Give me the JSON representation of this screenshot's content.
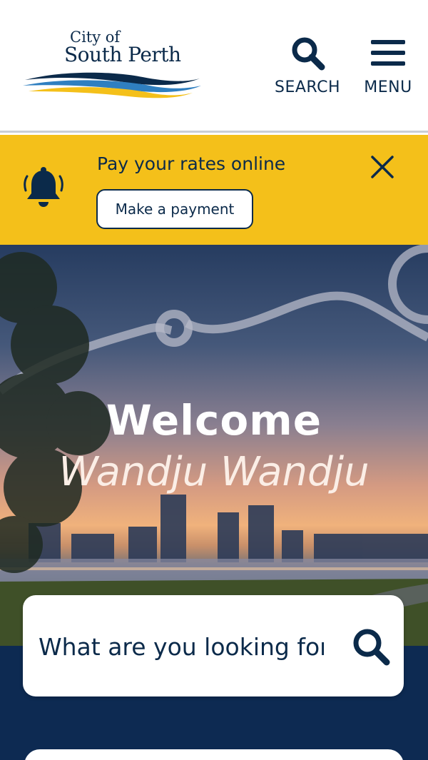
{
  "brand": {
    "city_of": "City of",
    "name": "South Perth",
    "colors": {
      "navy": "#0b2a4a",
      "yellow": "#f4c01a",
      "blue": "#2f7fc0",
      "band": "#0d2a52"
    }
  },
  "header": {
    "search_label": "SEARCH",
    "menu_label": "MENU",
    "search_icon": "search-icon",
    "menu_icon": "hamburger-icon"
  },
  "alert": {
    "icon": "bell-icon",
    "message": "Pay your rates online",
    "button_label": "Make a payment",
    "close_icon": "close-icon"
  },
  "hero": {
    "title": "Welcome",
    "subtitle": "Wandju Wandju"
  },
  "search": {
    "placeholder": "What are you looking for?",
    "icon": "search-icon"
  }
}
